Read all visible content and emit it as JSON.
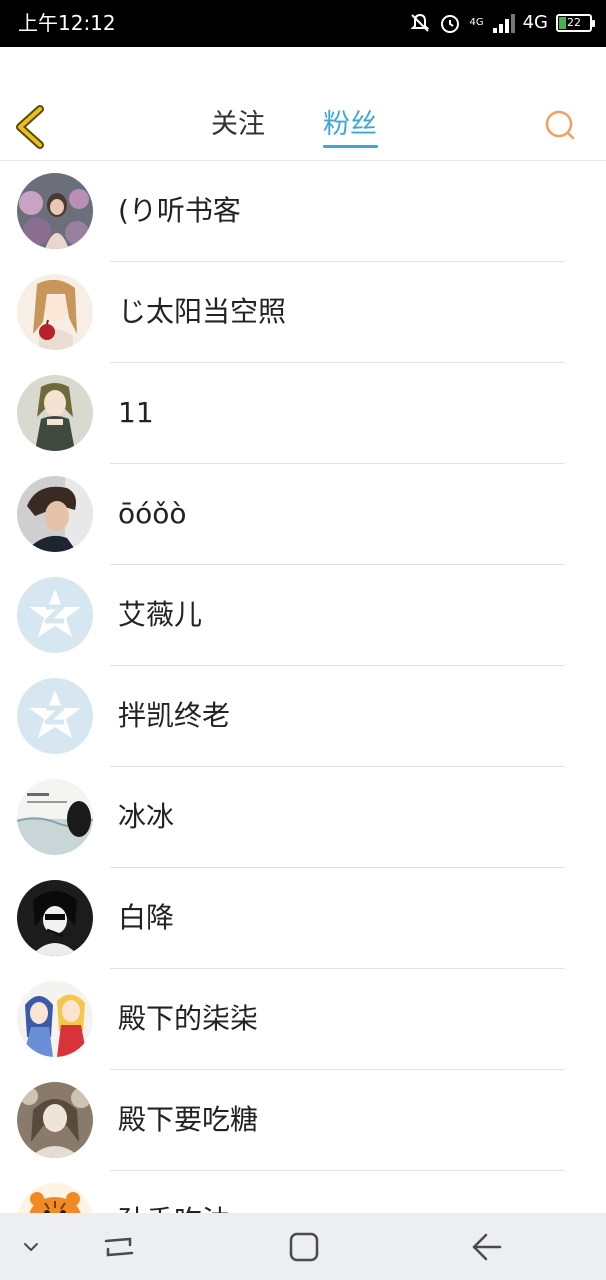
{
  "status_bar": {
    "time": "上午12:12",
    "net_small": "4G",
    "net": "4G",
    "battery": "22"
  },
  "header": {
    "tabs": [
      {
        "label": "关注",
        "active": false
      },
      {
        "label": "粉丝",
        "active": true
      }
    ]
  },
  "fans": [
    {
      "name": "(り听书客",
      "avatar": "girl-flowers-photo"
    },
    {
      "name": "じ太阳当空照",
      "avatar": "anime-girl-apple"
    },
    {
      "name": "11",
      "avatar": "anime-girl-green"
    },
    {
      "name": "ōóǒò",
      "avatar": "boy-photo"
    },
    {
      "name": "艾薇儿",
      "avatar": "default-qzone"
    },
    {
      "name": "拌凯终老",
      "avatar": "default-qzone"
    },
    {
      "name": "冰冰",
      "avatar": "sea-photo"
    },
    {
      "name": "白降",
      "avatar": "monochrome-anime"
    },
    {
      "name": "殿下的柒柒",
      "avatar": "anime-two-girls"
    },
    {
      "name": "殿下要吃糖",
      "avatar": "vintage-portrait"
    },
    {
      "name": "孙香吃油",
      "avatar": "tiger-cartoon"
    }
  ],
  "colors": {
    "accent": "#3fa7d8",
    "back_icon": "#e8c21a",
    "search_icon": "#f0a060"
  }
}
